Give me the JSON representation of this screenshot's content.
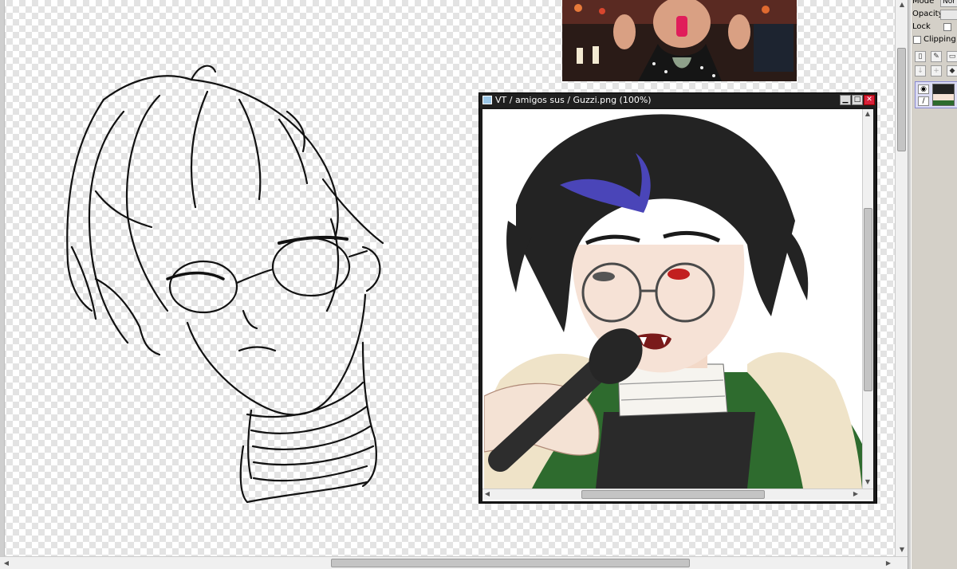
{
  "subwindow": {
    "title": "VT / amigos sus / Guzzi.png (100%)",
    "minimize": "▁",
    "maximize": "□",
    "close": "✕"
  },
  "panel": {
    "mode_label": "Mode",
    "mode_value": "Nor",
    "opacity_label": "Opacity",
    "lock_label": "Lock",
    "clipping_label": "Clipping G"
  },
  "scroll": {
    "up": "▲",
    "down": "▼",
    "left": "◀",
    "right": "▶"
  },
  "colors": {
    "title_bar": "#202020",
    "close_button": "#d8203a",
    "layer_selected": "#dcdcf4",
    "purple_hair": "#4a45b8",
    "jacket_green": "#2e6b2e",
    "fur_cream": "#efe3c8"
  }
}
